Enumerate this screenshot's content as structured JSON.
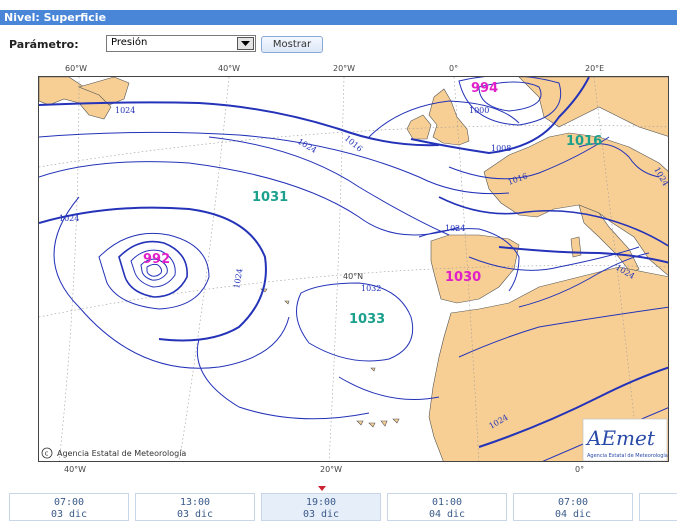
{
  "header": {
    "title": "Nivel: Superficie"
  },
  "controls": {
    "param_label": "Parámetro:",
    "param_value": "Presión",
    "button_label": "Mostrar"
  },
  "map": {
    "lon_top": [
      "60°W",
      "40°W",
      "20°W",
      "0°",
      "20°E"
    ],
    "lon_bottom": [
      "40°W",
      "20°W",
      "0°"
    ],
    "lat_label": "40°N",
    "isobars": [
      "1024",
      "1024",
      "1016",
      "1024",
      "1000",
      "1008",
      "1016",
      "1024",
      "1024",
      "1032",
      "1024",
      "1024",
      "1024"
    ],
    "centers": [
      {
        "value": "994",
        "kind": "low"
      },
      {
        "value": "1016",
        "kind": "high"
      },
      {
        "value": "1031",
        "kind": "high"
      },
      {
        "value": "992",
        "kind": "low"
      },
      {
        "value": "1030",
        "kind": "low"
      },
      {
        "value": "1033",
        "kind": "high"
      }
    ],
    "colors": {
      "low": "#e020c8",
      "high": "#1aa08c",
      "land": "#f7cf94",
      "isobar": "#2433b8"
    },
    "copyright": "Agencia Estatal de Meteorología",
    "logo_text": "AEmet",
    "logo_subtitle": "Agencia Estatal de Meteorología"
  },
  "timeline": [
    {
      "time": "07:00",
      "date": "03 dic",
      "active": false
    },
    {
      "time": "13:00",
      "date": "03 dic",
      "active": false
    },
    {
      "time": "19:00",
      "date": "03 dic",
      "active": true
    },
    {
      "time": "01:00",
      "date": "04 dic",
      "active": false
    },
    {
      "time": "07:00",
      "date": "04 dic",
      "active": false
    }
  ]
}
